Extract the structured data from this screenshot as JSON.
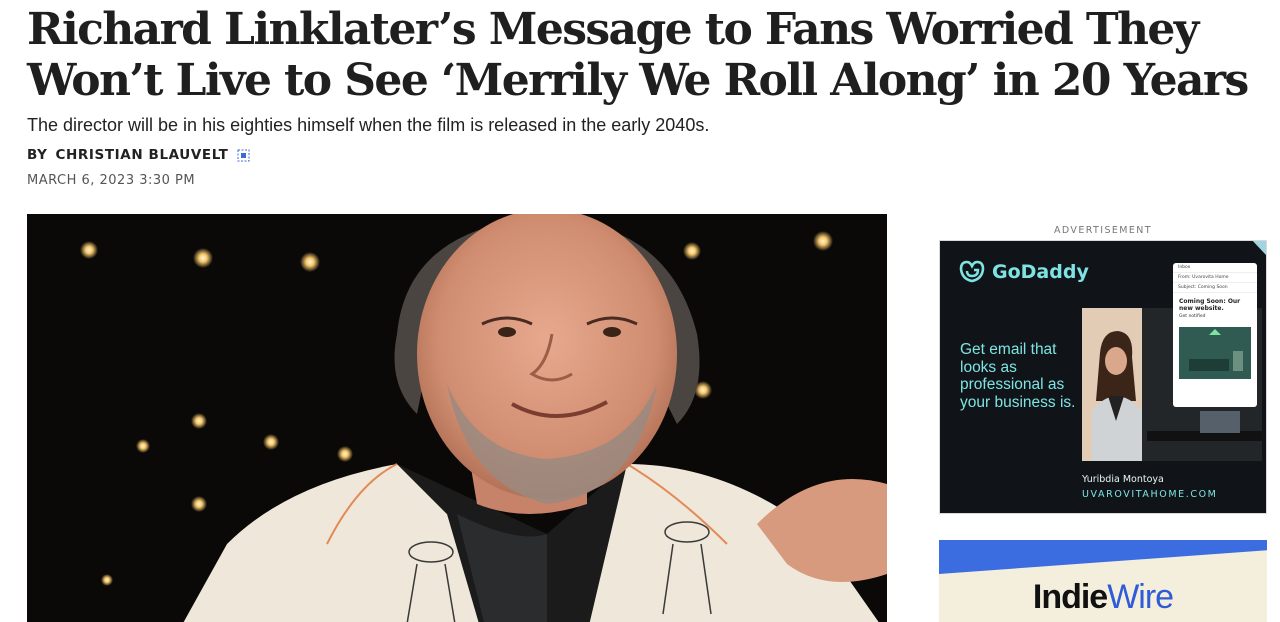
{
  "article": {
    "headline": "Richard Linklater’s Message to Fans Worried They Won’t Live to See ‘Merrily We Roll Along’ in 20 Years",
    "dek": "The director will be in his eighties himself when the film is released in the early 2040s.",
    "byline_prefix": "BY",
    "author": "CHRISTIAN BLAUVELT",
    "date": "MARCH 6, 2023 3:30 PM"
  },
  "ad": {
    "label": "ADVERTISEMENT",
    "brand": "GoDaddy",
    "copy": "Get email that looks as professional as your business is.",
    "person_name": "Yuribdia Montoya",
    "url": "UVAROVITAHOME.COM",
    "email_mock": {
      "inbox": "Inbox",
      "from_label": "From:",
      "from_value": "Uvarovita Home",
      "subject_label": "Subject:",
      "subject_value": "Coming Soon",
      "title": "Coming Soon: Our new website.",
      "link": "Get notified"
    },
    "colors": {
      "accent": "#7ee3e3",
      "background": "#101418"
    }
  },
  "promo": {
    "logo_part1": "Indie",
    "logo_part2": "Wire",
    "colors": {
      "band": "#3c6de0",
      "background": "#f3efdc"
    }
  },
  "icons": {
    "author_icon": "author-profile-icon",
    "brand_mark": "godaddy-logo-icon"
  }
}
